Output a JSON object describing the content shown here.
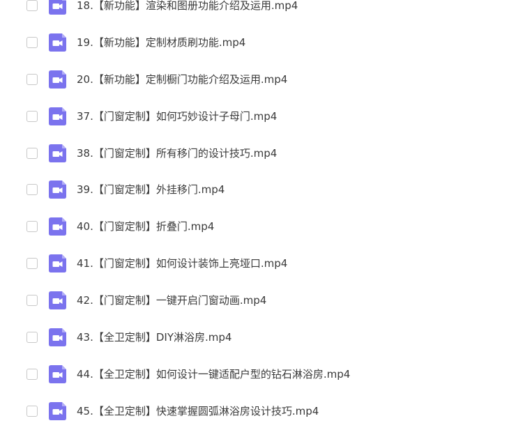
{
  "file_list": {
    "items": [
      {
        "name": "18.【新功能】渲染和图册功能介绍及运用.mp4",
        "icon": "video-file-icon",
        "checked": false
      },
      {
        "name": "19.【新功能】定制材质刷功能.mp4",
        "icon": "video-file-icon",
        "checked": false
      },
      {
        "name": "20.【新功能】定制橱门功能介绍及运用.mp4",
        "icon": "video-file-icon",
        "checked": false
      },
      {
        "name": "37.【门窗定制】如何巧妙设计子母门.mp4",
        "icon": "video-file-icon",
        "checked": false
      },
      {
        "name": "38.【门窗定制】所有移门的设计技巧.mp4",
        "icon": "video-file-icon",
        "checked": false
      },
      {
        "name": "39.【门窗定制】外挂移门.mp4",
        "icon": "video-file-icon",
        "checked": false
      },
      {
        "name": "40.【门窗定制】折叠门.mp4",
        "icon": "video-file-icon",
        "checked": false
      },
      {
        "name": "41.【门窗定制】如何设计装饰上亮垭口.mp4",
        "icon": "video-file-icon",
        "checked": false
      },
      {
        "name": "42.【门窗定制】一键开启门窗动画.mp4",
        "icon": "video-file-icon",
        "checked": false
      },
      {
        "name": "43.【全卫定制】DIY淋浴房.mp4",
        "icon": "video-file-icon",
        "checked": false
      },
      {
        "name": "44.【全卫定制】如何设计一键适配户型的钻石淋浴房.mp4",
        "icon": "video-file-icon",
        "checked": false
      },
      {
        "name": "45.【全卫定制】快速掌握圆弧淋浴房设计技巧.mp4",
        "icon": "video-file-icon",
        "checked": false
      }
    ]
  },
  "colors": {
    "icon_fill": "#7b73ee",
    "icon_fold": "#b3aef7",
    "icon_glyph": "#ffffff",
    "text": "#3a3a3a",
    "checkbox_border": "#c8c8c8"
  }
}
